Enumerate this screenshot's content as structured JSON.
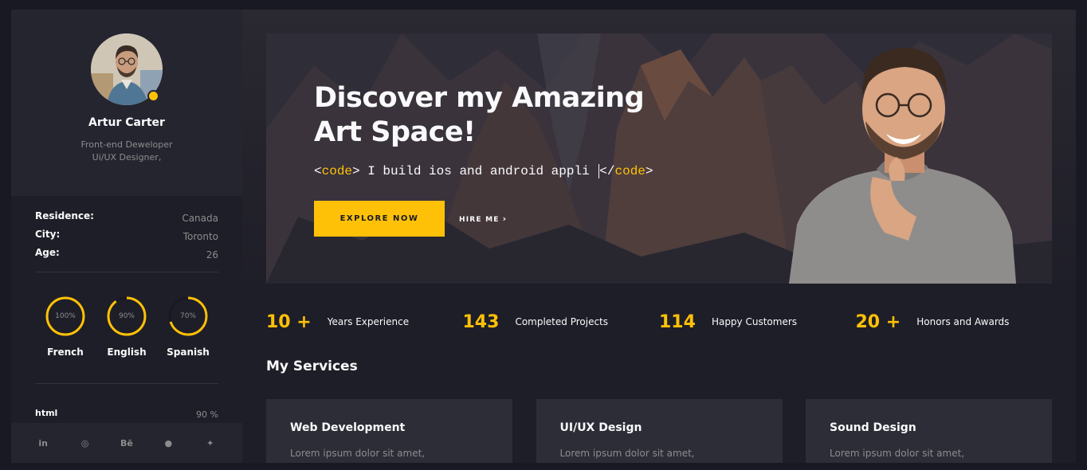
{
  "profile": {
    "name": "Artur Carter",
    "role_line1": "Front-end Deweloper",
    "role_line2": "Ui/UX Designer,"
  },
  "info": [
    {
      "key": "Residence:",
      "value": "Canada"
    },
    {
      "key": "City:",
      "value": "Toronto"
    },
    {
      "key": "Age:",
      "value": "26"
    }
  ],
  "languages": [
    {
      "label": "French",
      "percent_text": "100%",
      "level": 1.0
    },
    {
      "label": "English",
      "percent_text": "90%",
      "level": 0.9
    },
    {
      "label": "Spanish",
      "percent_text": "70%",
      "level": 0.7
    }
  ],
  "skills": [
    {
      "name": "html",
      "percent_text": "90 %"
    }
  ],
  "social": [
    {
      "icon": "linkedin-icon",
      "glyph": "in"
    },
    {
      "icon": "dribbble-icon",
      "glyph": "◎"
    },
    {
      "icon": "behance-icon",
      "glyph": "Bē"
    },
    {
      "icon": "github-icon",
      "glyph": "●"
    },
    {
      "icon": "twitter-icon",
      "glyph": "✦"
    }
  ],
  "banner": {
    "title_line1": "Discover my Amazing",
    "title_line2": "Art Space!",
    "code_open": "<code>",
    "code_text": " I build ios and android appli ",
    "code_close": "</code>",
    "explore_label": "EXPLORE NOW",
    "hire_label": "HIRE ME",
    "hire_icon": "chevron-right-icon"
  },
  "counters": [
    {
      "value": "10 +",
      "label": "Years Experience"
    },
    {
      "value": "143",
      "label": "Completed Projects"
    },
    {
      "value": "114",
      "label": "Happy Customers"
    },
    {
      "value": "20 +",
      "label": "Honors and Awards"
    }
  ],
  "services_title": "My Services",
  "services": [
    {
      "title": "Web Development",
      "text": "Lorem ipsum dolor sit amet,"
    },
    {
      "title": "UI/UX Design",
      "text": "Lorem ipsum dolor sit amet,"
    },
    {
      "title": "Sound Design",
      "text": "Lorem ipsum dolor sit amet,"
    }
  ],
  "colors": {
    "accent": "#ffc107",
    "background": "#191923",
    "panel": "#1e1e28",
    "card": "#2d2d38",
    "muted_text": "#8c8c8e"
  }
}
